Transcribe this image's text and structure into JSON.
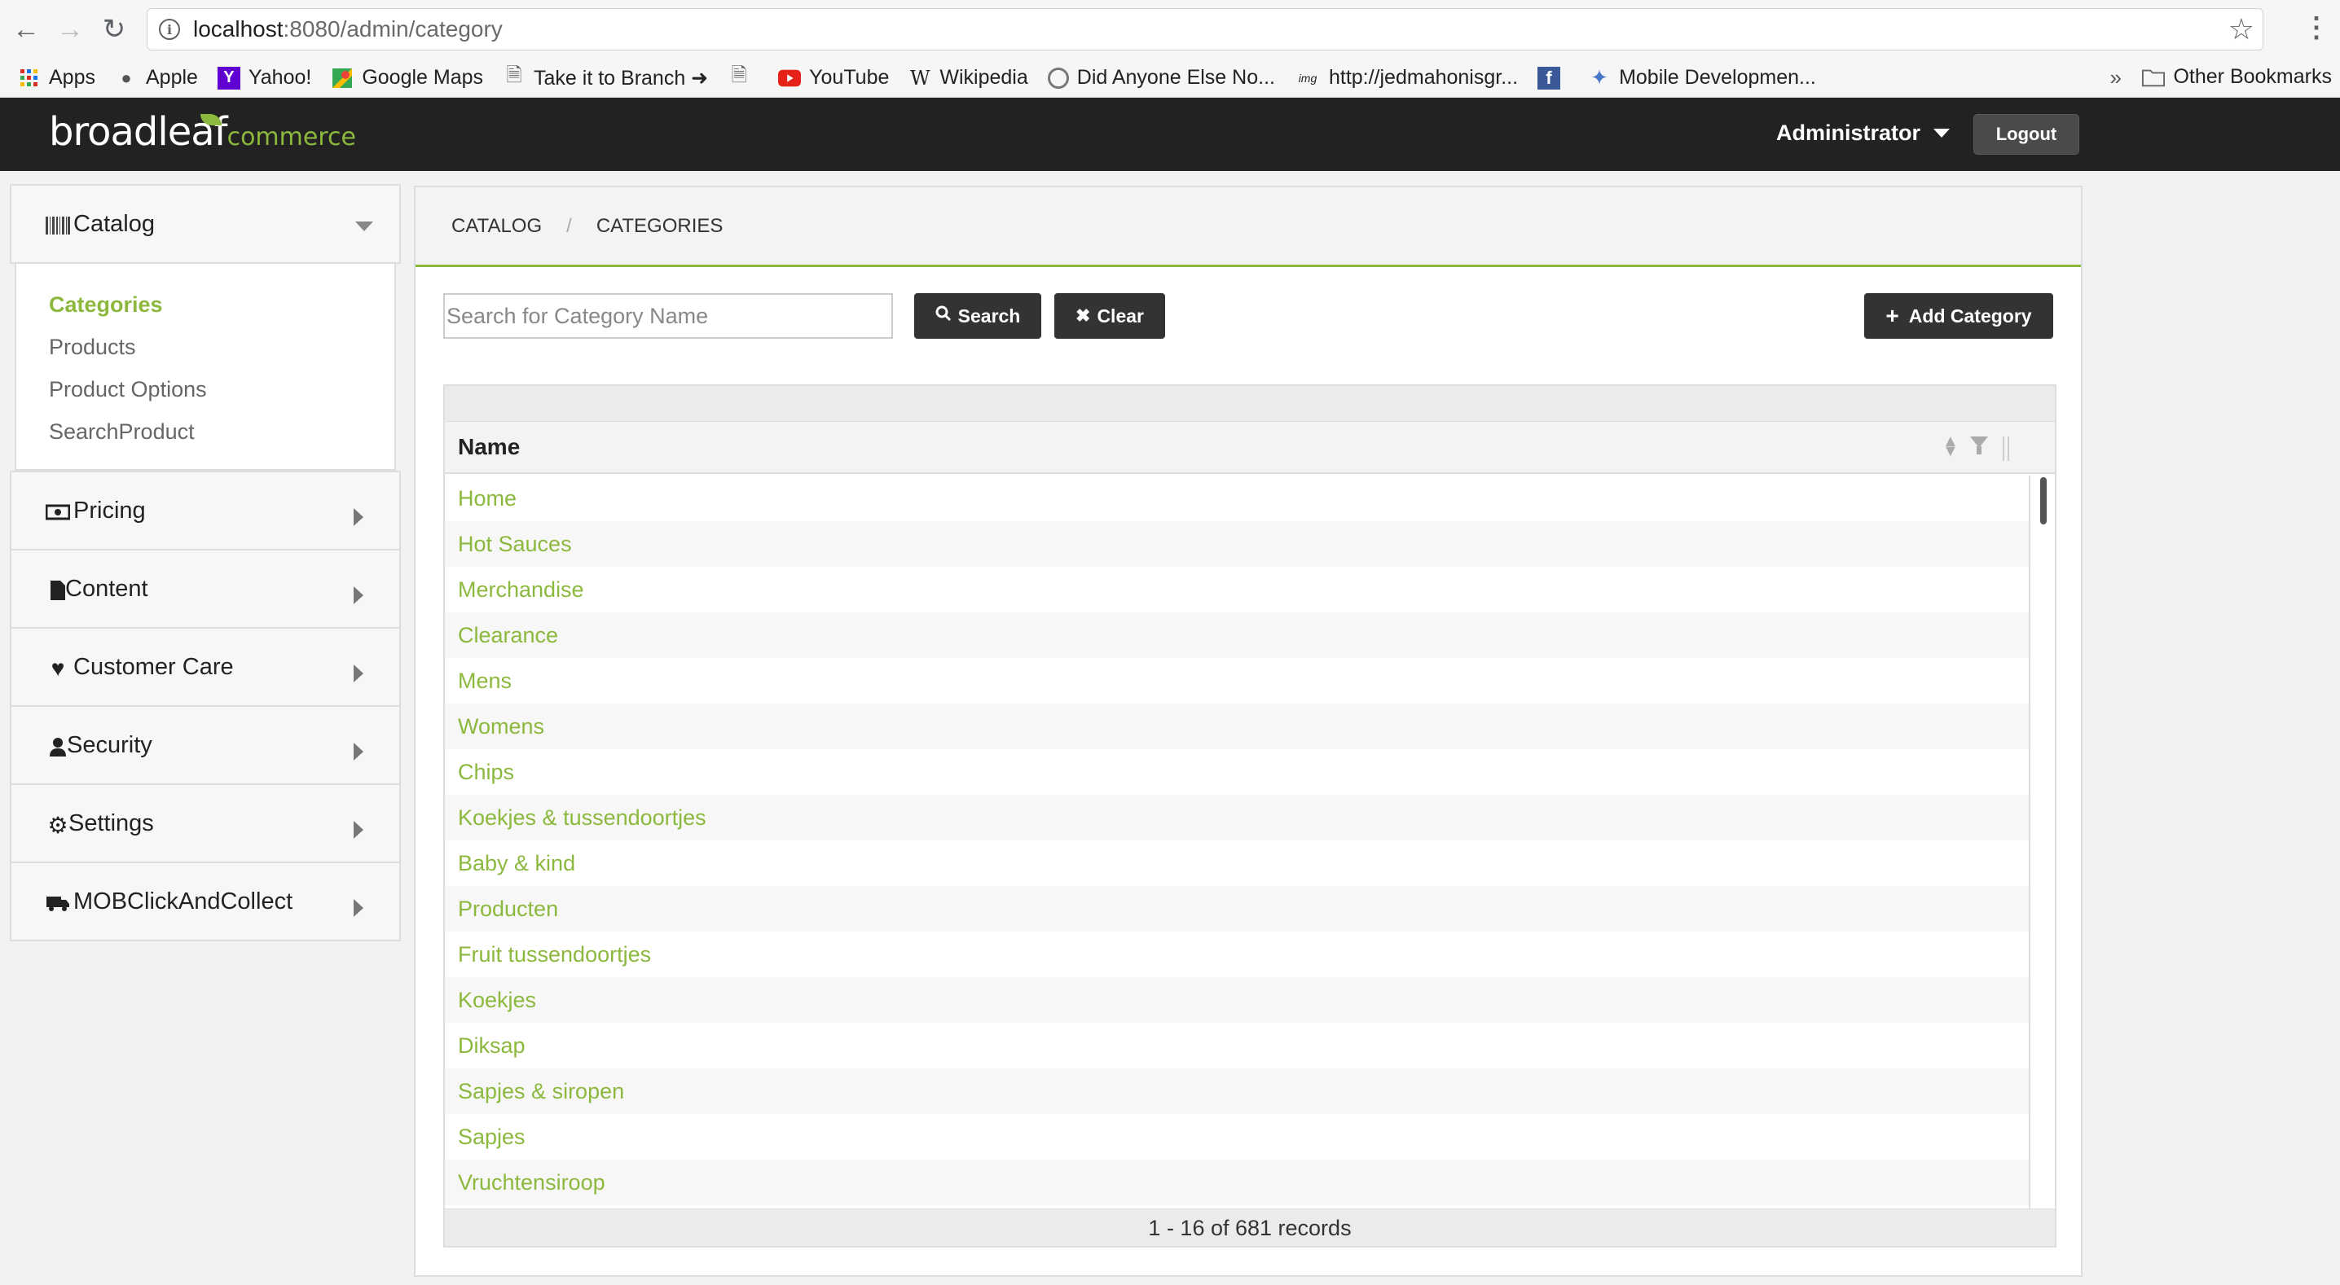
{
  "browser": {
    "url_host": "localhost",
    "url_path": ":8080/admin/category",
    "bookmarks": [
      {
        "label": "Apps",
        "icon": "apps-grid-icon"
      },
      {
        "label": "Apple",
        "icon": "apple-icon"
      },
      {
        "label": "Yahoo!",
        "icon": "yahoo-icon"
      },
      {
        "label": "Google Maps",
        "icon": "google-maps-icon"
      },
      {
        "label": "Take it to Branch ➜",
        "icon": "page-icon"
      },
      {
        "label": "",
        "icon": "page-icon"
      },
      {
        "label": "YouTube",
        "icon": "youtube-icon"
      },
      {
        "label": "Wikipedia",
        "icon": "wikipedia-icon"
      },
      {
        "label": "Did Anyone Else No...",
        "icon": "circle-icon"
      },
      {
        "label": "http://jedmahonisgr...",
        "icon": "img-icon"
      },
      {
        "label": "",
        "icon": "facebook-icon"
      },
      {
        "label": "Mobile Developmen...",
        "icon": "puzzle-icon"
      }
    ],
    "more": "»",
    "other_bookmarks": "Other Bookmarks"
  },
  "header": {
    "logo_main": "broadleaf",
    "logo_sub": "commerce",
    "user": "Administrator",
    "logout": "Logout"
  },
  "sidebar": {
    "catalog_label": "Catalog",
    "catalog_items": [
      "Categories",
      "Products",
      "Product Options",
      "SearchProduct"
    ],
    "sections": [
      {
        "label": "Pricing",
        "icon": "money-icon"
      },
      {
        "label": "Content",
        "icon": "file-icon"
      },
      {
        "label": "Customer Care",
        "icon": "heart-icon"
      },
      {
        "label": "Security",
        "icon": "user-icon"
      },
      {
        "label": "Settings",
        "icon": "gear-icon"
      },
      {
        "label": "MOBClickAndCollect",
        "icon": "truck-icon"
      }
    ]
  },
  "main": {
    "breadcrumb": [
      "CATALOG",
      "CATEGORIES"
    ],
    "search_placeholder": "Search for Category Name",
    "search_label": "Search",
    "clear_label": "Clear",
    "add_label": "Add Category",
    "column_name": "Name",
    "rows": [
      "Home",
      "Hot Sauces",
      "Merchandise",
      "Clearance",
      "Mens",
      "Womens",
      "Chips",
      "Koekjes & tussendoortjes",
      "Baby & kind",
      "Producten",
      "Fruit tussendoortjes",
      "Koekjes",
      "Diksap",
      "Sapjes & siropen",
      "Sapjes",
      "Vruchtensiroop"
    ],
    "records": "1 - 16 of 681 records"
  },
  "colors": {
    "accent": "#8cb83d",
    "header_bg": "#222222",
    "button_dark": "#333333"
  }
}
